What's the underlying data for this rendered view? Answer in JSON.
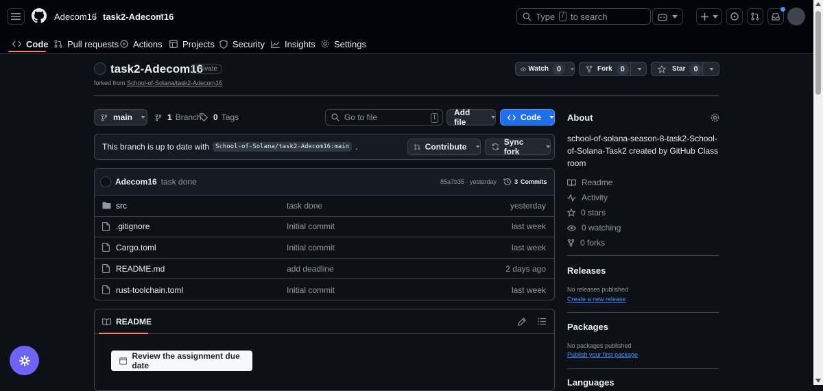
{
  "header": {
    "owner": "Adecom16",
    "separator": "/",
    "repo": "task2-Adecom16",
    "search_placeholder_prefix": "Type",
    "search_key": "/",
    "search_placeholder_suffix": "to search"
  },
  "tabs": [
    {
      "label": "Code",
      "icon": "code-icon",
      "active": true
    },
    {
      "label": "Pull requests",
      "icon": "pull-request-icon"
    },
    {
      "label": "Actions",
      "icon": "play-icon"
    },
    {
      "label": "Projects",
      "icon": "table-icon"
    },
    {
      "label": "Security",
      "icon": "shield-icon"
    },
    {
      "label": "Insights",
      "icon": "graph-icon"
    },
    {
      "label": "Settings",
      "icon": "gear-icon"
    }
  ],
  "repo": {
    "name": "task2-Adecom16",
    "visibility": "Private",
    "forked_from_label": "forked from",
    "forked_from": "School-of-Solana/task2-Adecom16",
    "watch_label": "Watch",
    "watch_count": "0",
    "fork_label": "Fork",
    "fork_count": "0",
    "star_label": "Star",
    "star_count": "0"
  },
  "toolbar": {
    "branch": "main",
    "branches_count": "1",
    "branches_label": "Branch",
    "tags_count": "0",
    "tags_label": "Tags",
    "goto_placeholder": "Go to file",
    "goto_key": "t",
    "add_file_label": "Add file",
    "code_label": "Code"
  },
  "sync": {
    "text": "This branch is up to date with",
    "ref": "School-of-Solana/task2-Adecom16:main",
    "period": ".",
    "contribute_label": "Contribute",
    "sync_label": "Sync fork"
  },
  "commit": {
    "author": "Adecom16",
    "message": "task done",
    "sha_time": "85a7b35 · yesterday",
    "commits_count": "3",
    "commits_label": "Commits"
  },
  "files": [
    {
      "name": "src",
      "type": "folder",
      "message": "task done",
      "date": "yesterday"
    },
    {
      "name": ".gitignore",
      "type": "file",
      "message": "Initial commit",
      "date": "last week"
    },
    {
      "name": "Cargo.toml",
      "type": "file",
      "message": "Initial commit",
      "date": "last week"
    },
    {
      "name": "README.md",
      "type": "file",
      "message": "add deadline",
      "date": "2 days ago"
    },
    {
      "name": "rust-toolchain.toml",
      "type": "file",
      "message": "Initial commit",
      "date": "last week"
    }
  ],
  "readme": {
    "label": "README",
    "button_label": "Review the assignment due date"
  },
  "about": {
    "heading": "About",
    "description": "school-of-solana-season-8-task2-School-of-Solana-Task2 created by GitHub Classroom",
    "readme": "Readme",
    "activity": "Activity",
    "stars": "0 stars",
    "watching": "0 watching",
    "forks": "0 forks"
  },
  "releases": {
    "heading": "Releases",
    "none": "No releases published",
    "create": "Create a new release"
  },
  "packages": {
    "heading": "Packages",
    "none": "No packages published",
    "publish": "Publish your first package"
  },
  "languages": {
    "heading": "Languages"
  },
  "colors": {
    "accent": "#1f6feb",
    "bg": "#0d1117",
    "tab_underline": "#f78166",
    "link": "#4493f8"
  }
}
